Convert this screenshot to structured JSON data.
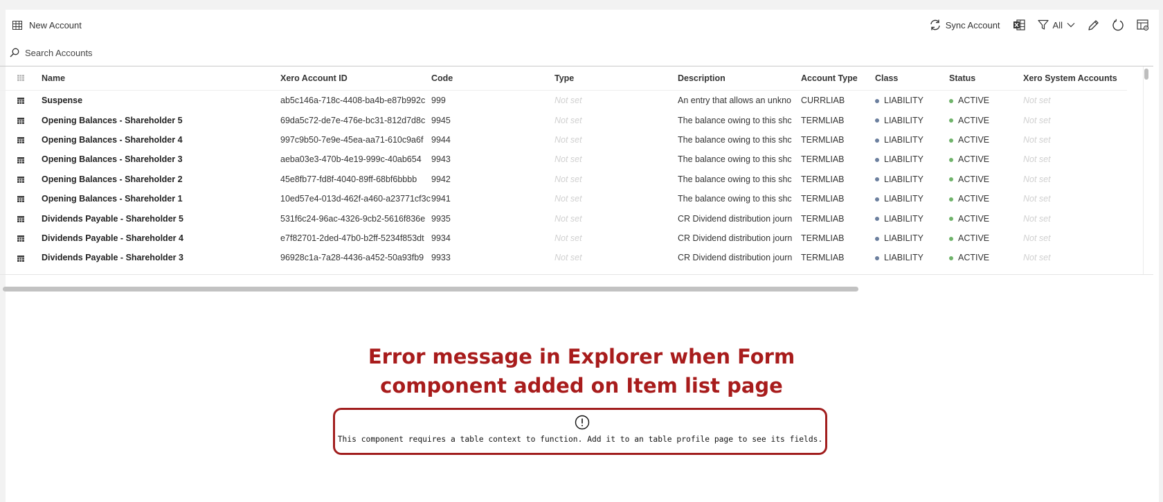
{
  "toolbar": {
    "new_account_label": "New Account",
    "sync_label": "Sync Account",
    "filter_label": "All"
  },
  "search": {
    "placeholder": "Search Accounts"
  },
  "table": {
    "columns": [
      "Name",
      "Xero Account ID",
      "Code",
      "Type",
      "Description",
      "Account Type",
      "Class",
      "Status",
      "Xero System Accounts"
    ],
    "rows": [
      {
        "name": "Suspense",
        "xero_id": "ab5c146a-718c-4408-ba4b-e87b992c",
        "code": "999",
        "type": "Not set",
        "description": "An entry that allows an unkno",
        "account_type": "CURRLIAB",
        "class": "LIABILITY",
        "status": "ACTIVE",
        "system": "Not set"
      },
      {
        "name": "Opening Balances - Shareholder 5",
        "xero_id": "69da5c72-de7e-476e-bc31-812d7d8c",
        "code": "9945",
        "type": "Not set",
        "description": "The balance owing to this shc",
        "account_type": "TERMLIAB",
        "class": "LIABILITY",
        "status": "ACTIVE",
        "system": "Not set"
      },
      {
        "name": "Opening Balances - Shareholder 4",
        "xero_id": "997c9b50-7e9e-45ea-aa71-610c9a6f",
        "code": "9944",
        "type": "Not set",
        "description": "The balance owing to this shc",
        "account_type": "TERMLIAB",
        "class": "LIABILITY",
        "status": "ACTIVE",
        "system": "Not set"
      },
      {
        "name": "Opening Balances - Shareholder 3",
        "xero_id": "aeba03e3-470b-4e19-999c-40ab654",
        "code": "9943",
        "type": "Not set",
        "description": "The balance owing to this shc",
        "account_type": "TERMLIAB",
        "class": "LIABILITY",
        "status": "ACTIVE",
        "system": "Not set"
      },
      {
        "name": "Opening Balances - Shareholder 2",
        "xero_id": "45e8fb77-fd8f-4040-89ff-68bf6bbbb",
        "code": "9942",
        "type": "Not set",
        "description": "The balance owing to this shc",
        "account_type": "TERMLIAB",
        "class": "LIABILITY",
        "status": "ACTIVE",
        "system": "Not set"
      },
      {
        "name": "Opening Balances - Shareholder 1",
        "xero_id": "10ed57e4-013d-462f-a460-a23771cf3c",
        "code": "9941",
        "type": "Not set",
        "description": "The balance owing to this shc",
        "account_type": "TERMLIAB",
        "class": "LIABILITY",
        "status": "ACTIVE",
        "system": "Not set"
      },
      {
        "name": "Dividends Payable - Shareholder 5",
        "xero_id": "531f6c24-96ac-4326-9cb2-5616f836e",
        "code": "9935",
        "type": "Not set",
        "description": "CR Dividend distribution journ",
        "account_type": "TERMLIAB",
        "class": "LIABILITY",
        "status": "ACTIVE",
        "system": "Not set"
      },
      {
        "name": "Dividends Payable - Shareholder 4",
        "xero_id": "e7f82701-2ded-47b0-b2ff-5234f853dt",
        "code": "9934",
        "type": "Not set",
        "description": "CR Dividend distribution journ",
        "account_type": "TERMLIAB",
        "class": "LIABILITY",
        "status": "ACTIVE",
        "system": "Not set"
      },
      {
        "name": "Dividends Payable - Shareholder 3",
        "xero_id": "96928c1a-7a28-4436-a452-50a93fb9",
        "code": "9933",
        "type": "Not set",
        "description": "CR Dividend distribution journ",
        "account_type": "TERMLIAB",
        "class": "LIABILITY",
        "status": "ACTIVE",
        "system": "Not set"
      }
    ]
  },
  "annotation": {
    "line1": "Error message in Explorer when Form",
    "line2": "component added on Item list page"
  },
  "error": {
    "message": "This component requires a table context to function. Add it to an table profile page to see its fields."
  },
  "colors": {
    "liability_dot": "#6b7f9e",
    "active_dot": "#6fb36a",
    "annotation_red": "#a81c1c"
  }
}
